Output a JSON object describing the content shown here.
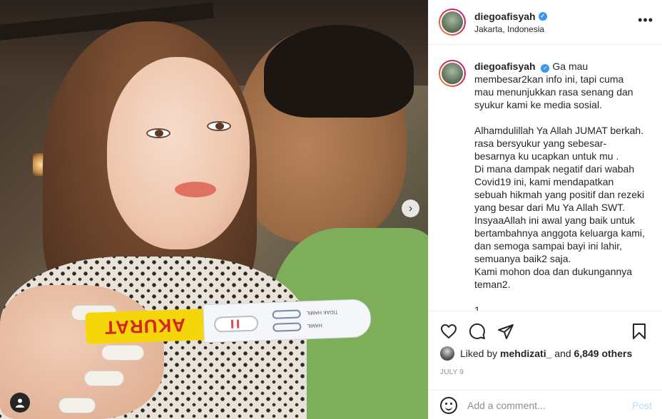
{
  "photo": {
    "test_brand": "AKURAT",
    "mini_label_1": "TIDAK HAMIL",
    "mini_label_2": "HAMIL"
  },
  "header": {
    "username": "diegoafisyah",
    "location": "Jakarta, Indonesia",
    "more_icon": "more-dots-icon"
  },
  "caption": {
    "username": "diegoafisyah",
    "lines_p1": "Ga mau membesar2kan info ini, tapi cuma mau menunjukkan rasa senang dan syukur kami ke media sosial.",
    "lines_p2a": "Alhamdulillah Ya Allah JUMAT berkah.",
    "lines_p2b": "rasa bersyukur yang sebesar-besarnya ku ucapkan untuk mu .",
    "lines_p2c": "Di mana dampak negatif dari wabah Covid19 ini, kami mendapatkan sebuah hikmah yang positif dan rezeki yang besar dari Mu Ya Allah SWT.",
    "lines_p2d": "InsyaaAllah ini awal yang baik untuk bertambahnya anggota keluarga kami, dan semoga sampai bayi ini lahir, semuanya baik2 saja.",
    "lines_p2e": "Kami mohon doa dan dukungannya teman2.",
    "ellipsis": "1..."
  },
  "likes": {
    "prefix": "Liked by",
    "user": "mehdizati_",
    "joiner": "and",
    "others": "6,849 others"
  },
  "date": "JULY 9",
  "comment": {
    "placeholder": "Add a comment...",
    "post_label": "Post"
  },
  "colors": {
    "verified": "#3897f0",
    "post_disabled": "#b2dffc"
  }
}
